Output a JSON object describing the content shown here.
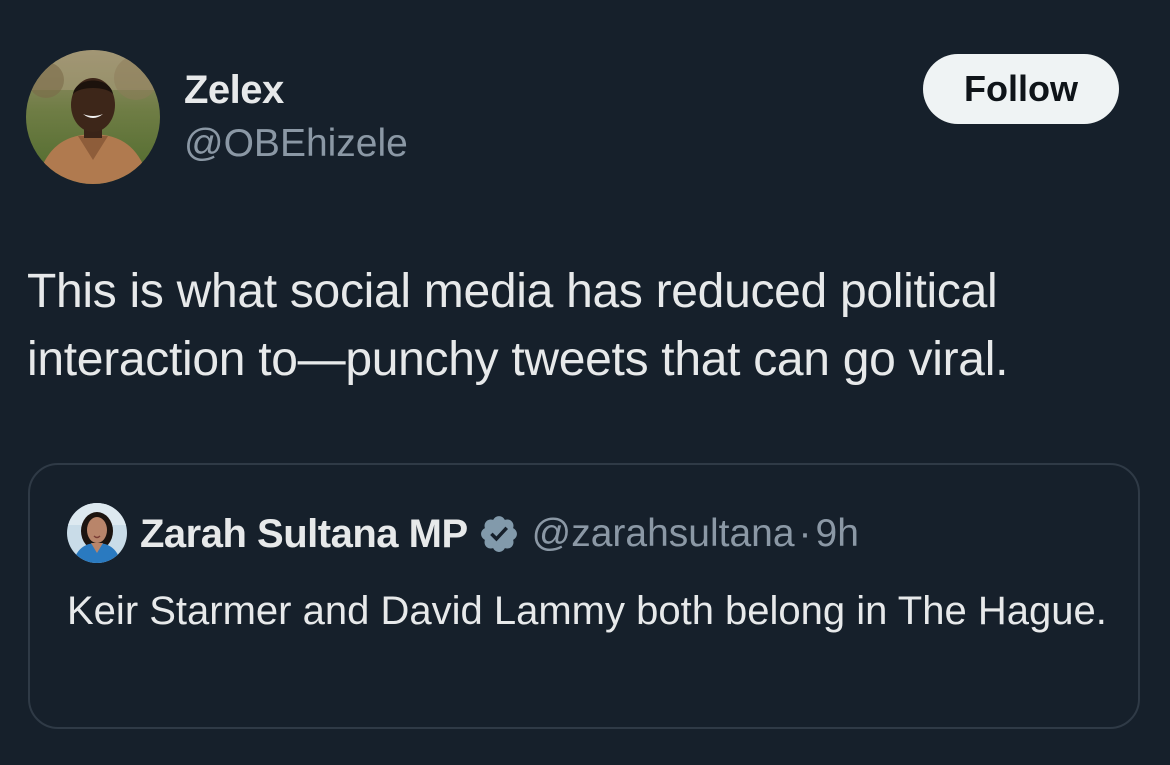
{
  "theme": {
    "background": "#16202b",
    "text_primary": "#e7e9ea",
    "text_secondary": "#8b98a5",
    "verified_badge": "#829aab",
    "follow_button_bg": "#eff3f4",
    "card_border": "#2f3a46"
  },
  "tweet": {
    "author": {
      "name": "Zelex",
      "handle": "@OBEhizele",
      "avatar_icon": "profile-photo"
    },
    "follow_label": "Follow",
    "text": "This is what social media has reduced political interaction to—punchy tweets that can go viral."
  },
  "quoted_tweet": {
    "author": {
      "name": "Zarah Sultana MP",
      "handle": "@zarahsultana",
      "verified_icon": "verified-badge-icon",
      "avatar_icon": "profile-photo"
    },
    "separator": "·",
    "time": "9h",
    "text": "Keir Starmer and David Lammy both belong in The Hague."
  }
}
